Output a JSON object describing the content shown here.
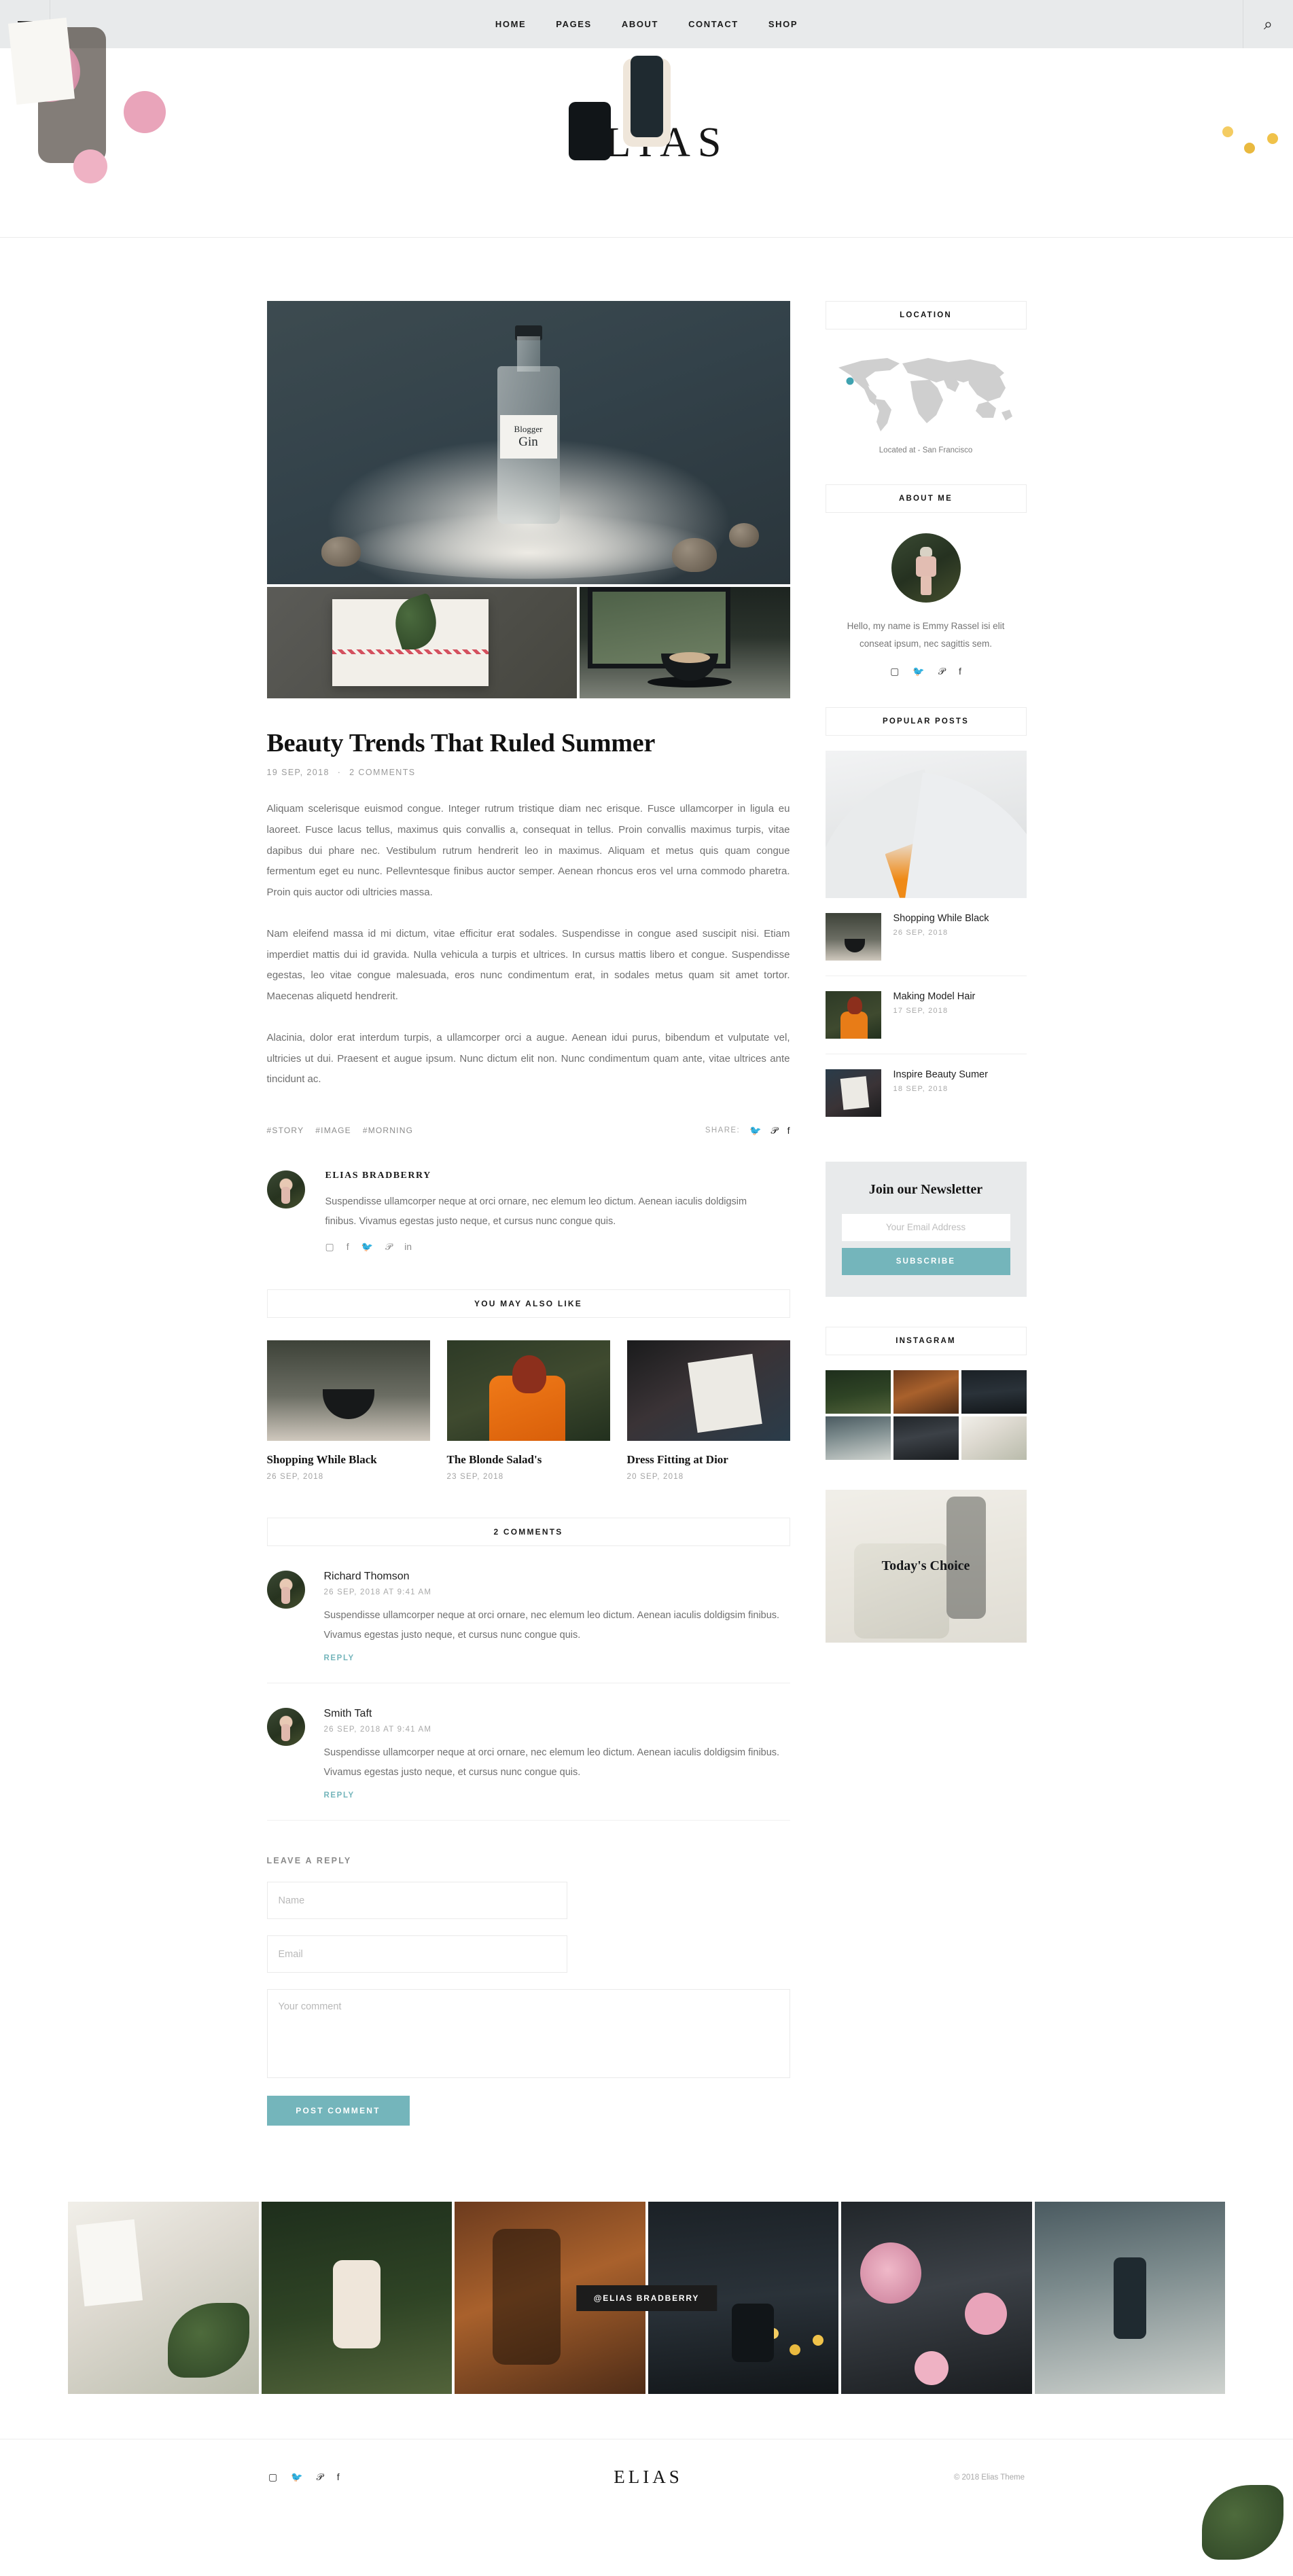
{
  "topbar": {
    "menu_icon": "hamburger-icon",
    "search_icon": "search-icon",
    "nav": [
      {
        "label": "HOME"
      },
      {
        "label": "PAGES"
      },
      {
        "label": "ABOUT"
      },
      {
        "label": "CONTACT"
      },
      {
        "label": "SHOP"
      }
    ]
  },
  "brand": {
    "logo": "ELIAS"
  },
  "post": {
    "title": "Beauty Trends That Ruled Summer",
    "date": "19 SEP, 2018",
    "separator": "·",
    "comments_count": "2 COMMENTS",
    "paragraphs": [
      "Aliquam scelerisque euismod congue. Integer rutrum tristique diam nec erisque. Fusce ullamcorper in ligula eu laoreet. Fusce lacus tellus, maximus quis convallis a, consequat in tellus. Proin convallis maximus turpis, vitae dapibus dui phare nec. Vestibulum rutrum hendrerit leo in maximus. Aliquam et metus quis quam congue fermentum eget eu nunc. Pellevntesque finibus auctor semper. Aenean rhoncus eros vel urna commodo pharetra. Proin quis auctor odi ultricies massa.",
      "Nam eleifend massa id mi dictum, vitae efficitur erat sodales. Suspendisse in congue ased suscipit nisi. Etiam imperdiet mattis dui id gravida. Nulla vehicula a turpis et ultrices. In cursus mattis libero et congue. Suspendisse egestas, leo vitae congue malesuada, eros nunc condimentum erat, in sodales metus quam sit amet tortor. Maecenas aliquetd hendrerit.",
      "Alacinia, dolor erat interdum turpis, a ullamcorper orci a augue. Aenean idui purus, bibendum et vulputate vel, ultricies ut dui. Praesent et augue ipsum. Nunc dictum elit non. Nunc condimentum quam ante, vitae ultrices ante tincidunt ac."
    ],
    "tags": [
      "#STORY",
      "#IMAGE",
      "#MORNING"
    ],
    "share_label": "SHARE:",
    "share_icons": [
      "twitter-icon",
      "pinterest-icon",
      "facebook-icon"
    ],
    "gallery": {
      "main_alt": "gin-bottle-photo",
      "bottle_label_line1": "Blogger",
      "bottle_label_line2": "Gin",
      "thumb1_alt": "gift-box-with-leaf-photo",
      "thumb2_alt": "coffee-by-window-photo"
    }
  },
  "author": {
    "name": "ELIAS BRADBERRY",
    "bio": "Suspendisse ullamcorper neque at orci ornare, nec elemum leo dictum. Aenean iaculis doldigsim finibus. Vivamus egestas justo neque, et cursus nunc congue quis.",
    "social": [
      "instagram-icon",
      "facebook-icon",
      "twitter-icon",
      "pinterest-icon",
      "linkedin-icon"
    ]
  },
  "related": {
    "heading": "YOU MAY ALSO LIKE",
    "items": [
      {
        "title": "Shopping While Black",
        "date": "26 SEP, 2018"
      },
      {
        "title": "The Blonde Salad's",
        "date": "23 SEP, 2018"
      },
      {
        "title": "Dress Fitting at Dior",
        "date": "20 SEP, 2018"
      }
    ]
  },
  "comments": {
    "heading": "2 COMMENTS",
    "items": [
      {
        "name": "Richard Thomson",
        "date": "26 SEP, 2018 AT 9:41 AM",
        "text": "Suspendisse ullamcorper neque at orci ornare, nec elemum leo dictum. Aenean iaculis doldigsim finibus. Vivamus egestas justo neque, et cursus nunc congue quis.",
        "reply": "REPLY"
      },
      {
        "name": "Smith Taft",
        "date": "26 SEP, 2018 AT 9:41 AM",
        "text": "Suspendisse ullamcorper neque at orci ornare, nec elemum leo dictum. Aenean iaculis doldigsim finibus. Vivamus egestas justo neque, et cursus nunc congue quis.",
        "reply": "REPLY"
      }
    ]
  },
  "reply_form": {
    "heading": "LEAVE A REPLY",
    "name_placeholder": "Name",
    "email_placeholder": "Email",
    "comment_placeholder": "Your comment",
    "submit_label": "POST COMMENT"
  },
  "sidebar": {
    "location": {
      "title": "LOCATION",
      "caption": "Located at - San Francisco",
      "marker_color": "#3fa2b0"
    },
    "about": {
      "title": "ABOUT ME",
      "text": "Hello, my name is Emmy Rassel isi elit conseat ipsum, nec sagittis sem.",
      "social": [
        "instagram-icon",
        "twitter-icon",
        "pinterest-icon",
        "facebook-icon"
      ]
    },
    "popular": {
      "title": "POPULAR POSTS",
      "hero_alt": "opera-house-photo",
      "items": [
        {
          "title": "Shopping While Black",
          "date": "26 SEP, 2018"
        },
        {
          "title": "Making Model Hair",
          "date": "17 SEP, 2018"
        },
        {
          "title": "Inspire Beauty Sumer",
          "date": "18 SEP, 2018"
        }
      ]
    },
    "newsletter": {
      "title": "Join our Newsletter",
      "email_placeholder": "Your Email Address",
      "submit_label": "SUBSCRIBE"
    },
    "instagram": {
      "title": "INSTAGRAM",
      "cells": [
        "ig-1",
        "ig-2",
        "ig-3",
        "ig-4",
        "ig-5",
        "ig-6"
      ]
    },
    "choice": {
      "title": "Today's Choice"
    }
  },
  "instagram_strip": {
    "badge": "@ELIAS BRADBERRY",
    "cells": [
      "strip-1",
      "strip-2",
      "strip-3",
      "strip-4",
      "strip-5",
      "strip-6"
    ]
  },
  "footer": {
    "social": [
      "instagram-icon",
      "twitter-icon",
      "pinterest-icon",
      "facebook-icon"
    ],
    "logo": "ELIAS",
    "copyright": "© 2018 Elias Theme"
  },
  "theme": {
    "accent": "#74b5bb",
    "bar_bg": "#e8eaeb",
    "text": "#2b2b2b"
  }
}
